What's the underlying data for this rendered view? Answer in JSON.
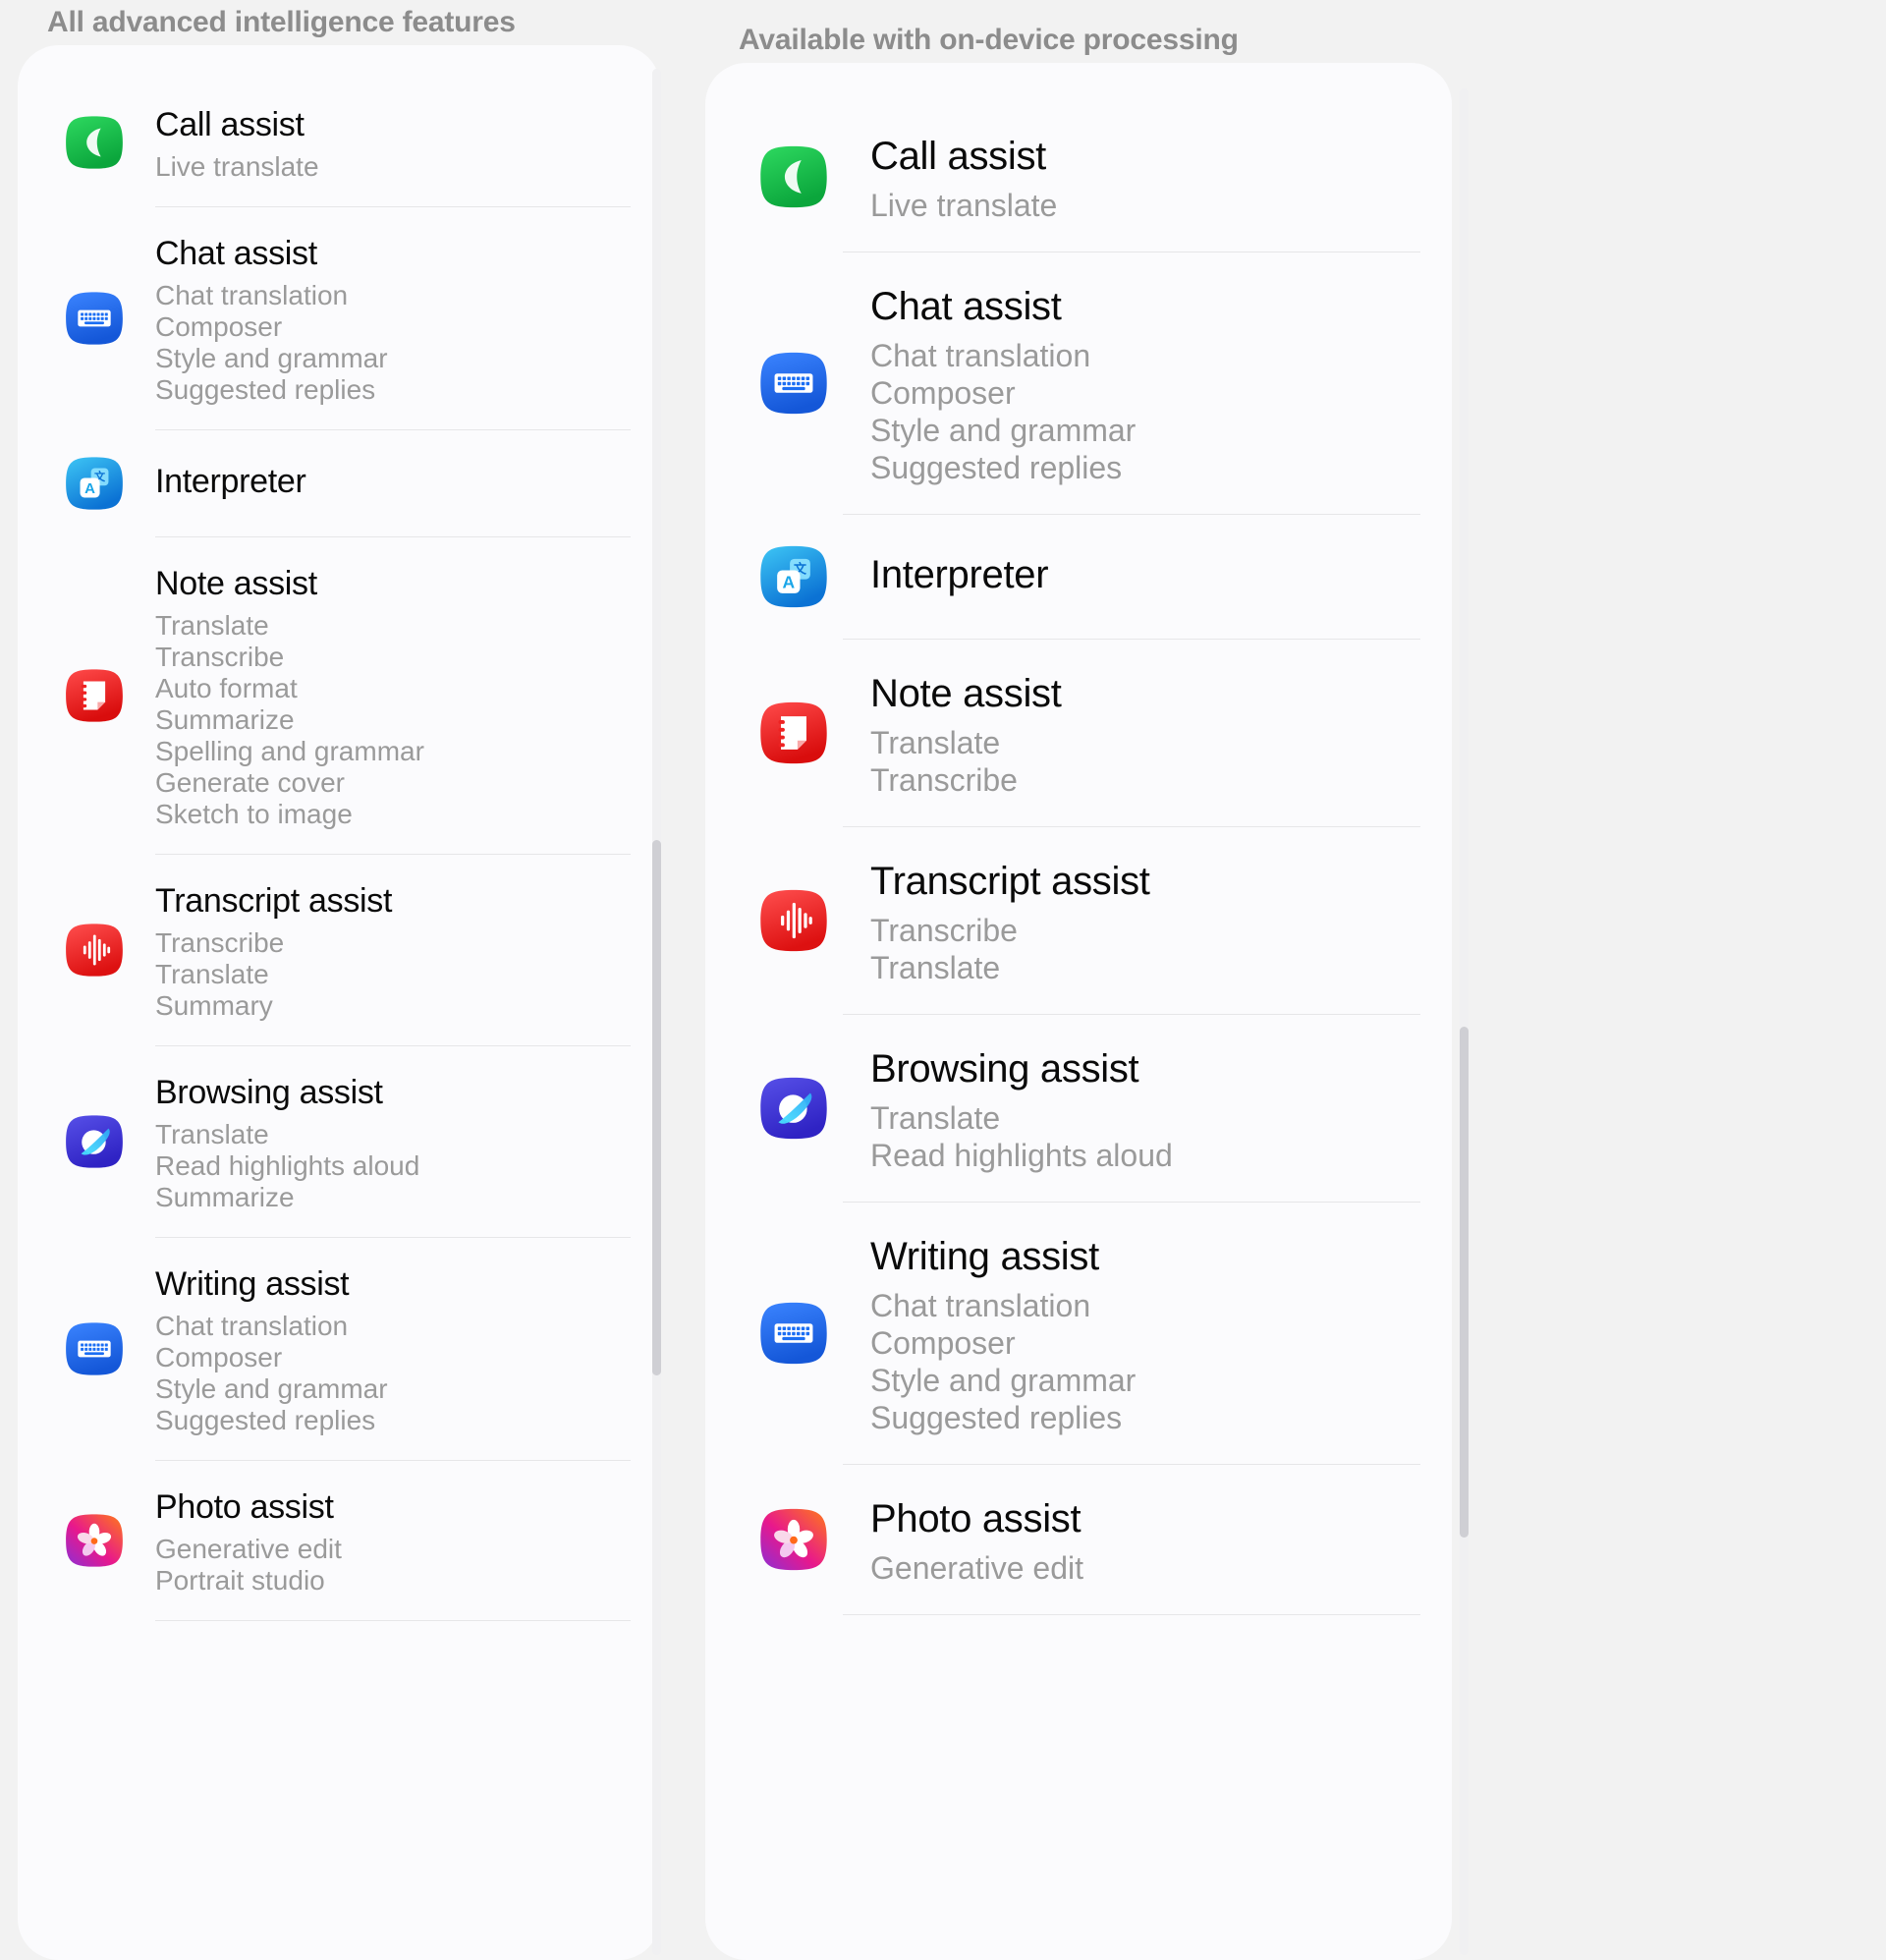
{
  "columns": {
    "left": {
      "header": "All advanced intelligence features",
      "features": [
        {
          "title": "Call assist",
          "icon": "phone-icon",
          "subitems": [
            "Live translate"
          ]
        },
        {
          "title": "Chat assist",
          "icon": "keyboard-icon",
          "subitems": [
            "Chat translation",
            "Composer",
            "Style and grammar",
            "Suggested replies"
          ]
        },
        {
          "title": "Interpreter",
          "icon": "interpreter-icon",
          "subitems": []
        },
        {
          "title": "Note assist",
          "icon": "notes-icon",
          "subitems": [
            "Translate",
            "Transcribe",
            "Auto format",
            "Summarize",
            "Spelling and grammar",
            "Generate cover",
            "Sketch to image"
          ]
        },
        {
          "title": "Transcript assist",
          "icon": "waveform-icon",
          "subitems": [
            "Transcribe",
            "Translate",
            "Summary"
          ]
        },
        {
          "title": "Browsing assist",
          "icon": "browser-icon",
          "subitems": [
            "Translate",
            "Read highlights aloud",
            "Summarize"
          ]
        },
        {
          "title": "Writing assist",
          "icon": "keyboard-icon",
          "subitems": [
            "Chat translation",
            "Composer",
            "Style and grammar",
            "Suggested replies"
          ]
        },
        {
          "title": "Photo assist",
          "icon": "gallery-icon",
          "subitems": [
            "Generative edit",
            "Portrait studio"
          ]
        }
      ]
    },
    "right": {
      "header": "Available with on-device processing",
      "features": [
        {
          "title": "Call assist",
          "icon": "phone-icon",
          "subitems": [
            "Live translate"
          ]
        },
        {
          "title": "Chat assist",
          "icon": "keyboard-icon",
          "subitems": [
            "Chat translation",
            "Composer",
            "Style and grammar",
            "Suggested replies"
          ]
        },
        {
          "title": "Interpreter",
          "icon": "interpreter-icon",
          "subitems": []
        },
        {
          "title": "Note assist",
          "icon": "notes-icon",
          "subitems": [
            "Translate",
            "Transcribe"
          ]
        },
        {
          "title": "Transcript assist",
          "icon": "waveform-icon",
          "subitems": [
            "Transcribe",
            "Translate"
          ]
        },
        {
          "title": "Browsing assist",
          "icon": "browser-icon",
          "subitems": [
            "Translate",
            "Read highlights aloud"
          ]
        },
        {
          "title": "Writing assist",
          "icon": "keyboard-icon",
          "subitems": [
            "Chat translation",
            "Composer",
            "Style and grammar",
            "Suggested replies"
          ]
        },
        {
          "title": "Photo assist",
          "icon": "gallery-icon",
          "subitems": [
            "Generative edit"
          ]
        }
      ]
    }
  },
  "colors": {
    "page_background": "#f2f2f2",
    "card_background": "#fbfbfd",
    "title_text": "#0a0a0a",
    "subitem_text": "#9a9a9a",
    "header_text": "#8c8c8c",
    "divider": "#e6e6e8",
    "scrollbar_thumb": "#cfcfd4",
    "icon_phone": "#17c04a",
    "icon_keyboard": "#1b6ef3",
    "icon_interpreter": "#13a7e8",
    "icon_notes": "#ee2222",
    "icon_waveform": "#f02222",
    "icon_browser": "#3f3ddb",
    "icon_gallery": "#e0159a"
  }
}
